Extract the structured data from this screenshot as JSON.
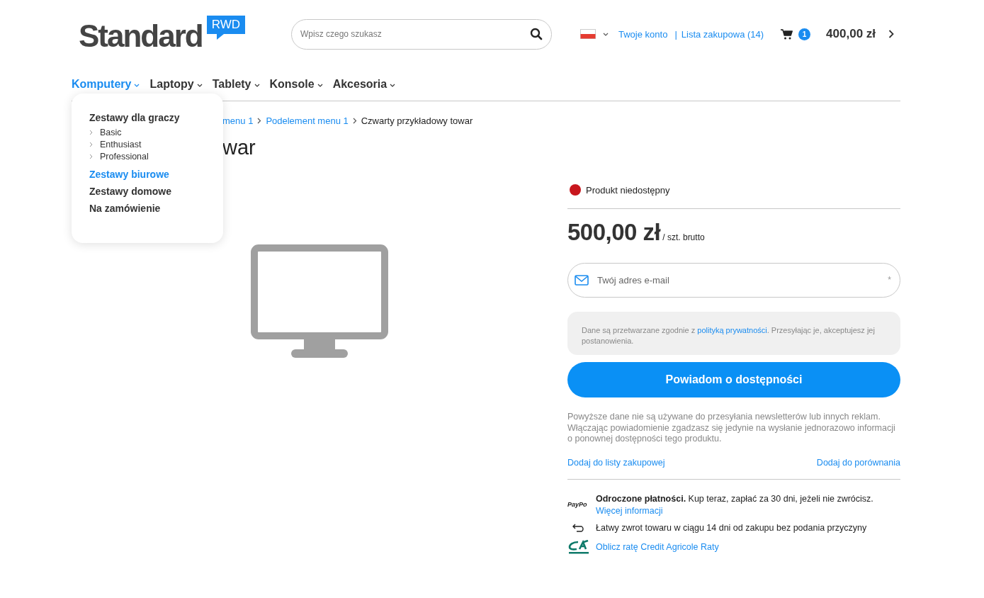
{
  "logo": {
    "word": "Standard",
    "badge": "RWD"
  },
  "search": {
    "placeholder": "Wpisz czego szukasz"
  },
  "account_links": [
    "Twoje konto",
    "Lista zakupowa (14)"
  ],
  "account_separator": "|",
  "cart": {
    "count": "1",
    "total": "400,00 zł"
  },
  "nav": [
    {
      "label": "Komputery",
      "selected": true
    },
    {
      "label": "Laptopy",
      "selected": false
    },
    {
      "label": "Tablety",
      "selected": false
    },
    {
      "label": "Konsole",
      "selected": false
    },
    {
      "label": "Akcesoria",
      "selected": false
    }
  ],
  "dropdown": [
    {
      "label": "Zestawy dla graczy",
      "selected": false,
      "children": [
        {
          "label": "Basic"
        },
        {
          "label": "Enthusiast"
        },
        {
          "label": "Professional"
        }
      ]
    },
    {
      "label": "Zestawy biurowe",
      "selected": true
    },
    {
      "label": "Zestawy domowe",
      "selected": false
    },
    {
      "label": "Na zamówienie",
      "selected": false
    }
  ],
  "breadcrumb": [
    {
      "label": "menu 1",
      "link": true
    },
    {
      "label": "Podelement menu 1",
      "link": true
    },
    {
      "label": "Czwarty przykładowy towar",
      "link": false
    }
  ],
  "title": "war",
  "availability": {
    "text": "Produkt niedostępny",
    "color": "#c8161d"
  },
  "price": {
    "amount": "500,00 zł",
    "unit": "/ szt. brutto"
  },
  "email": {
    "placeholder": "Twój adres e-mail",
    "required_mark": "*"
  },
  "consent": {
    "before": "Dane są przetwarzane zgodnie z ",
    "link": "polityką prywatności",
    "after": ". Przesyłając je, akceptujesz jej postanowienia."
  },
  "notify_button": "Powiadom o dostępności",
  "disclaimer": "Powyższe dane nie są używane do przesyłania newsletterów lub innych reklam. Włączając powiadomienie zgadzasz się jedynie na wysłanie jednorazowo informacji o ponownej dostępności tego produktu.",
  "actions": [
    "Dodaj do listy zakupowej",
    "Dodaj do porównania"
  ],
  "benefits": [
    {
      "kind": "paypo",
      "logo": "PayPo",
      "text": "**Odroczone płatności.** Kup teraz, zapłać za 30 dni, jeżeli nie zwrócisz.",
      "link": "Więcej informacji"
    },
    {
      "kind": "return",
      "text": "Łatwy zwrot towaru w ciągu 14 dni od zakupu bez podania przyczyny"
    },
    {
      "kind": "credit",
      "link": "Oblicz ratę Credit Agricole Raty"
    }
  ]
}
